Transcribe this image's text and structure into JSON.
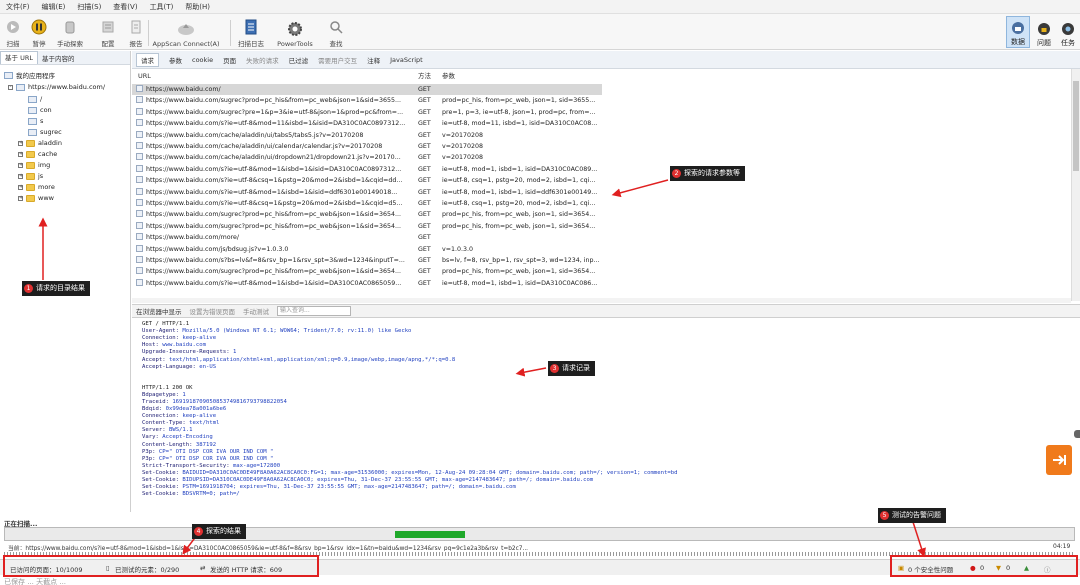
{
  "menu": [
    "文件(F)",
    "编辑(E)",
    "扫描(S)",
    "查看(V)",
    "工具(T)",
    "帮助(H)"
  ],
  "toolbar": {
    "items": [
      {
        "label": "扫描",
        "icon": "scan-icon"
      },
      {
        "label": "暂停",
        "icon": "pause-icon"
      },
      {
        "label": "手动探索",
        "icon": "hand-icon"
      },
      {
        "label": "配置",
        "icon": "config-icon"
      },
      {
        "label": "报告",
        "icon": "report-icon"
      },
      {
        "label": "AppScan Connect(A)",
        "icon": "cloud-upload-icon"
      },
      {
        "label": "扫描日志",
        "icon": "log-icon"
      },
      {
        "label": "PowerTools",
        "icon": "gear-icon"
      },
      {
        "label": "查找",
        "icon": "search-icon"
      }
    ],
    "right": [
      {
        "label": "数据",
        "icon": "data-icon"
      },
      {
        "label": "问题",
        "icon": "issues-icon"
      },
      {
        "label": "任务",
        "icon": "tasks-icon"
      }
    ]
  },
  "leftpanel": {
    "tabs": [
      "基于 URL",
      "基于内容的"
    ],
    "root": "我的应用程序",
    "site": "https://www.baidu.com/",
    "nodes": [
      "/",
      "con",
      "s",
      "sugrec",
      "aladdin",
      "cache",
      "img",
      "js",
      "more",
      "www"
    ]
  },
  "reqtabs": {
    "items": [
      "请求",
      "参数",
      "cookie",
      "页面",
      "失败的请求",
      "已过滤",
      "需要用户交互",
      "注释",
      "JavaScript"
    ]
  },
  "table": {
    "col_url": "URL",
    "col_method": "方法",
    "col_params": "参数",
    "rows": [
      {
        "url": "https://www.baidu.com/",
        "method": "GET",
        "params": ""
      },
      {
        "url": "https://www.baidu.com/sugrec?prod=pc_his&from=pc_web&json=1&sid=3655...",
        "method": "GET",
        "params": "prod=pc_his, from=pc_web, json=1, sid=3655..."
      },
      {
        "url": "https://www.baidu.com/sugrec?pre=1&p=3&ie=utf-8&json=1&prod=pc&from=...",
        "method": "GET",
        "params": "pre=1, p=3, ie=utf-8, json=1, prod=pc, from=..."
      },
      {
        "url": "https://www.baidu.com/s?ie=utf-8&mod=11&isbd=1&isid=DA310C0AC0897312...",
        "method": "GET",
        "params": "ie=utf-8, mod=11, isbd=1, isid=DA310C0AC08..."
      },
      {
        "url": "https://www.baidu.com/cache/aladdin/ui/tabs5/tabs5.js?v=20170208",
        "method": "GET",
        "params": "v=20170208"
      },
      {
        "url": "https://www.baidu.com/cache/aladdin/ui/calendar/calendar.js?v=20170208",
        "method": "GET",
        "params": "v=20170208"
      },
      {
        "url": "https://www.baidu.com/cache/aladdin/ui/dropdown21/dropdown21.js?v=20170...",
        "method": "GET",
        "params": "v=20170208"
      },
      {
        "url": "https://www.baidu.com/s?ie=utf-8&mod=1&isbd=1&isid=DA310C0AC0897312...",
        "method": "GET",
        "params": "ie=utf-8, mod=1, isbd=1, isid=DA310C0AC089..."
      },
      {
        "url": "https://www.baidu.com/s?ie=utf-8&csq=1&pstg=20&mod=2&isbd=1&cqid=dd...",
        "method": "GET",
        "params": "ie=utf-8, csq=1, pstg=20, mod=2, isbd=1, cqi..."
      },
      {
        "url": "https://www.baidu.com/s?ie=utf-8&mod=1&isbd=1&isid=ddf6301e00149018...",
        "method": "GET",
        "params": "ie=utf-8, mod=1, isbd=1, isid=ddf6301e00149..."
      },
      {
        "url": "https://www.baidu.com/s?ie=utf-8&csq=1&pstg=20&mod=2&isbd=1&cqid=d5...",
        "method": "GET",
        "params": "ie=utf-8, csq=1, pstg=20, mod=2, isbd=1, cqi..."
      },
      {
        "url": "https://www.baidu.com/sugrec?prod=pc_his&from=pc_web&json=1&sid=3654...",
        "method": "GET",
        "params": "prod=pc_his, from=pc_web, json=1, sid=3654..."
      },
      {
        "url": "https://www.baidu.com/sugrec?prod=pc_his&from=pc_web&json=1&sid=3654...",
        "method": "GET",
        "params": "prod=pc_his, from=pc_web, json=1, sid=3654..."
      },
      {
        "url": "https://www.baidu.com/more/",
        "method": "GET",
        "params": ""
      },
      {
        "url": "https://www.baidu.com/js/bdsug.js?v=1.0.3.0",
        "method": "GET",
        "params": "v=1.0.3.0"
      },
      {
        "url": "https://www.baidu.com/s?bs=lv&f=8&rsv_bp=1&rsv_spt=3&wd=1234&inputT=...",
        "method": "GET",
        "params": "bs=lv, f=8, rsv_bp=1, rsv_spt=3, wd=1234, inp..."
      },
      {
        "url": "https://www.baidu.com/sugrec?prod=pc_his&from=pc_web&json=1&sid=3654...",
        "method": "GET",
        "params": "prod=pc_his, from=pc_web, json=1, sid=3654..."
      },
      {
        "url": "https://www.baidu.com/s?ie=utf-8&mod=1&isbd=1&isid=DA310C0AC0865059...",
        "method": "GET",
        "params": "ie=utf-8, mod=1, isbd=1, isid=DA310C0AC086..."
      }
    ]
  },
  "inspect": {
    "tabs": [
      "在浏览器中显示",
      "设置为错误页面",
      "手动测试"
    ],
    "search_placeholder": "输入查询..."
  },
  "raw": {
    "request": [
      [
        "GET / HTTP/1.1",
        ""
      ],
      [
        "User-Agent: ",
        "Mozilla/5.0 (Windows NT 6.1; WOW64; Trident/7.0; rv:11.0) like Gecko"
      ],
      [
        "Connection: ",
        "keep-alive"
      ],
      [
        "Host: ",
        "www.baidu.com"
      ],
      [
        "Upgrade-Insecure-Requests: ",
        "1"
      ],
      [
        "Accept: ",
        "text/html,application/xhtml+xml,application/xml;q=0.9,image/webp,image/apng,*/*;q=0.8"
      ],
      [
        "Accept-Language: ",
        "en-US"
      ]
    ],
    "response": [
      [
        "HTTP/1.1 200 OK",
        ""
      ],
      [
        "Bdpagetype: ",
        "1"
      ],
      [
        "Traceid: ",
        "1691918709050853749816793798822054"
      ],
      [
        "Bdqid: ",
        "0x99dea78a001a6be6"
      ],
      [
        "Connection: ",
        "keep-alive"
      ],
      [
        "Content-Type: ",
        "text/html"
      ],
      [
        "Server: ",
        "BWS/1.1"
      ],
      [
        "Vary: ",
        "Accept-Encoding"
      ],
      [
        "Content-Length: ",
        "387192"
      ],
      [
        "P3p: ",
        "CP=\" OTI DSP COR IVA OUR IND COM \""
      ],
      [
        "P3p: ",
        "CP=\" OTI DSP COR IVA OUR IND COM \""
      ],
      [
        "Strict-Transport-Security: ",
        "max-age=172800"
      ],
      [
        "Set-Cookie: ",
        "BAIDUID=DA310C0AC0DE49F8A0A62AC8CA0C0:FG=1; max-age=31536000; expires=Mon, 12-Aug-24 09:28:04 GMT; domain=.baidu.com; path=/; version=1; comment=bd"
      ],
      [
        "Set-Cookie: ",
        "BIDUPSID=DA310C0AC0DE49F8A0A62AC8CA0C0; expires=Thu, 31-Dec-37 23:55:55 GMT; max-age=2147483647; path=/; domain=.baidu.com"
      ],
      [
        "Set-Cookie: ",
        "PSTM=1691918704; expires=Thu, 31-Dec-37 23:55:55 GMT; max-age=2147483647; path=/; domain=.baidu.com"
      ],
      [
        "Set-Cookie: ",
        "BDSVRTM=0; path=/"
      ]
    ]
  },
  "progress": {
    "label": "正在扫描...",
    "current": "当前：https://www.baidu.com/s?ie=utf-8&mod=1&isbd=1&isid=DA310C0AC0865059&ie=utf-8&f=8&rsv_bp=1&rsv_idx=1&tn=baidu&wd=1234&rsv_pq=9c1e2a3b&rsv_t=b2c7...",
    "time": "04:19"
  },
  "status": {
    "visited": "已访问的页面：10/1009",
    "tested": "已测试的元素：0/290",
    "http": "发送的 HTTP 请求：609",
    "issues": "0 个安全性问题",
    "high": "0",
    "medium": "0",
    "bottom": "已保存 ... 天截点 ..."
  },
  "annotations": [
    {
      "num": "1",
      "text": "请求的目录结果"
    },
    {
      "num": "2",
      "text": "探索的请求参数等"
    },
    {
      "num": "3",
      "text": "请求记录"
    },
    {
      "num": "4",
      "text": "探索的结果"
    },
    {
      "num": "5",
      "text": "测试的告警问题"
    }
  ],
  "colors": {
    "annotation_red": "#e02020",
    "progress_green": "#1fa82a",
    "callout_bg": "#1e1e1e"
  }
}
